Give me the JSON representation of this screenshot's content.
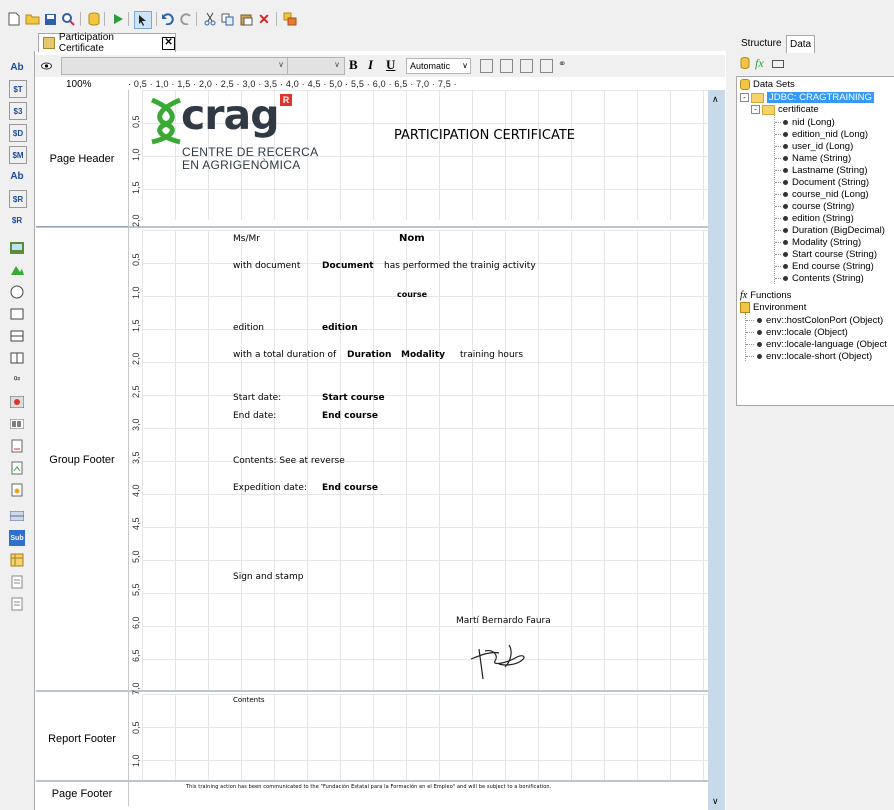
{
  "toolbar": {
    "icons": [
      "new-icon",
      "open-icon",
      "save-icon",
      "preview-icon",
      "database-icon",
      "run-icon",
      "select-icon",
      "undo-icon",
      "redo-icon",
      "cut-icon",
      "copy-icon",
      "paste-icon",
      "delete-icon",
      "query-icon"
    ]
  },
  "editor": {
    "tab_title": "Participation Certificate",
    "zoom": "100%",
    "format_bar": {
      "color_value": "Automatic",
      "bold": "B",
      "italic": "I",
      "underline": "U"
    },
    "ruler_text": "· 0,5 · 1,0 · 1,5 · 2,0 · 2,5 · 3,0 · 3,5 · 4,0 · 4,5 · 5,0 · 5,5 · 6,0 · 6,5 · 7,0 · 7,5 ·"
  },
  "bands": {
    "page_header": "Page Header",
    "group_footer": "Group Footer",
    "report_footer": "Report Footer",
    "page_footer": "Page Footer"
  },
  "report": {
    "logo_word": "crag",
    "logo_line1": "CENTRE DE RECERCA",
    "logo_line2": "EN AGRIGENÒMICA",
    "title": "PARTICIPATION CERTIFICATE",
    "fields": {
      "msmr": "Ms/Mr",
      "nom": "Nom",
      "with_document": "with document",
      "document": "Document",
      "has_performed": "has performed the trainig activity",
      "course": "course",
      "edition_label": "edition",
      "edition_value": "edition",
      "total_duration": "with a total duration of",
      "duration": "Duration",
      "modality": "Modality",
      "training_hours": "training hours",
      "start_date_label": "Start date:",
      "start_course": "Start course",
      "end_date_label": "End date:",
      "end_course": "End course",
      "contents_see": "Contents: See at reverse",
      "expedition_label": "Expedition date:",
      "expedition_value": "End course",
      "sign_stamp": "Sign and stamp",
      "signer": "Martí Bernardo Faura",
      "contents": "Contents",
      "footer_note": "This training action has been communicated to the \"Fundación Estatal para la Formación en el Empleo\" and will be subject to a bonification."
    },
    "vruler_header": [
      "0,5",
      "1,0",
      "1,5",
      "2,0"
    ],
    "vruler_group": [
      "0,5",
      "1,0",
      "1,5",
      "2,0",
      "2,5",
      "3,0",
      "3,5",
      "4,0",
      "4,5",
      "5,0",
      "5,5",
      "6,0",
      "6,5",
      "7,0"
    ],
    "vruler_report": [
      "0,5",
      "1,0"
    ]
  },
  "right_panel": {
    "tabs": [
      "Structure",
      "Data"
    ],
    "tree": {
      "data_sets": "Data Sets",
      "jdbc": "JDBC: CRAGTRAINING",
      "certificate": "certificate",
      "columns": [
        "nid (Long)",
        "edition_nid (Long)",
        "user_id (Long)",
        "Name (String)",
        "Lastname (String)",
        "Document (String)",
        "course_nid (Long)",
        "course (String)",
        "edition (String)",
        "Duration (BigDecimal)",
        "Modality (String)",
        "Start course (String)",
        "End course (String)",
        "Contents (String)"
      ],
      "functions": "Functions",
      "environment": "Environment",
      "env_items": [
        "env::hostColonPort (Object)",
        "env::locale (Object)",
        "env::locale-language (Object",
        "env::locale-short (Object)"
      ]
    }
  },
  "colors": {
    "selection": "#3399ff",
    "band_sep": "#b8c7d4",
    "scroll": "#c8daea",
    "logo_green": "#3aa935",
    "logo_dark": "#2f3a44",
    "logo_red": "#e2332a"
  }
}
